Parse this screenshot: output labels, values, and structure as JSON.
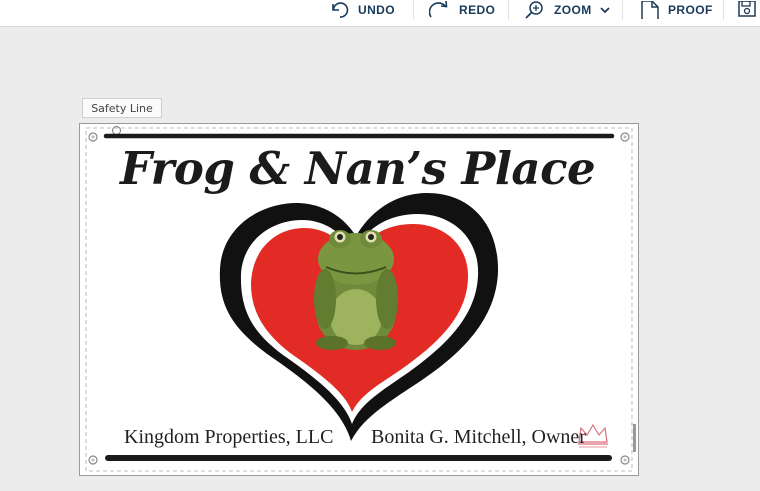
{
  "toolbar": {
    "undo_label": "UNDO",
    "redo_label": "REDO",
    "zoom_label": "ZOOM",
    "proof_label": "PROOF"
  },
  "editor": {
    "safety_line_label": "Safety Line"
  },
  "design": {
    "title": "Frog & Nan’s Place",
    "footer_left": "Kingdom Properties, LLC",
    "footer_right": "Bonita G. Mitchell, Owner"
  },
  "colors": {
    "heart_red": "#e32b26",
    "heart_outline": "#111111",
    "toolbar_text": "#1a3a5a",
    "crown": "#d9727a"
  },
  "icons": {
    "undo": "undo-icon",
    "redo": "redo-icon",
    "zoom": "zoom-in-icon",
    "proof": "document-icon",
    "save": "save-icon"
  }
}
